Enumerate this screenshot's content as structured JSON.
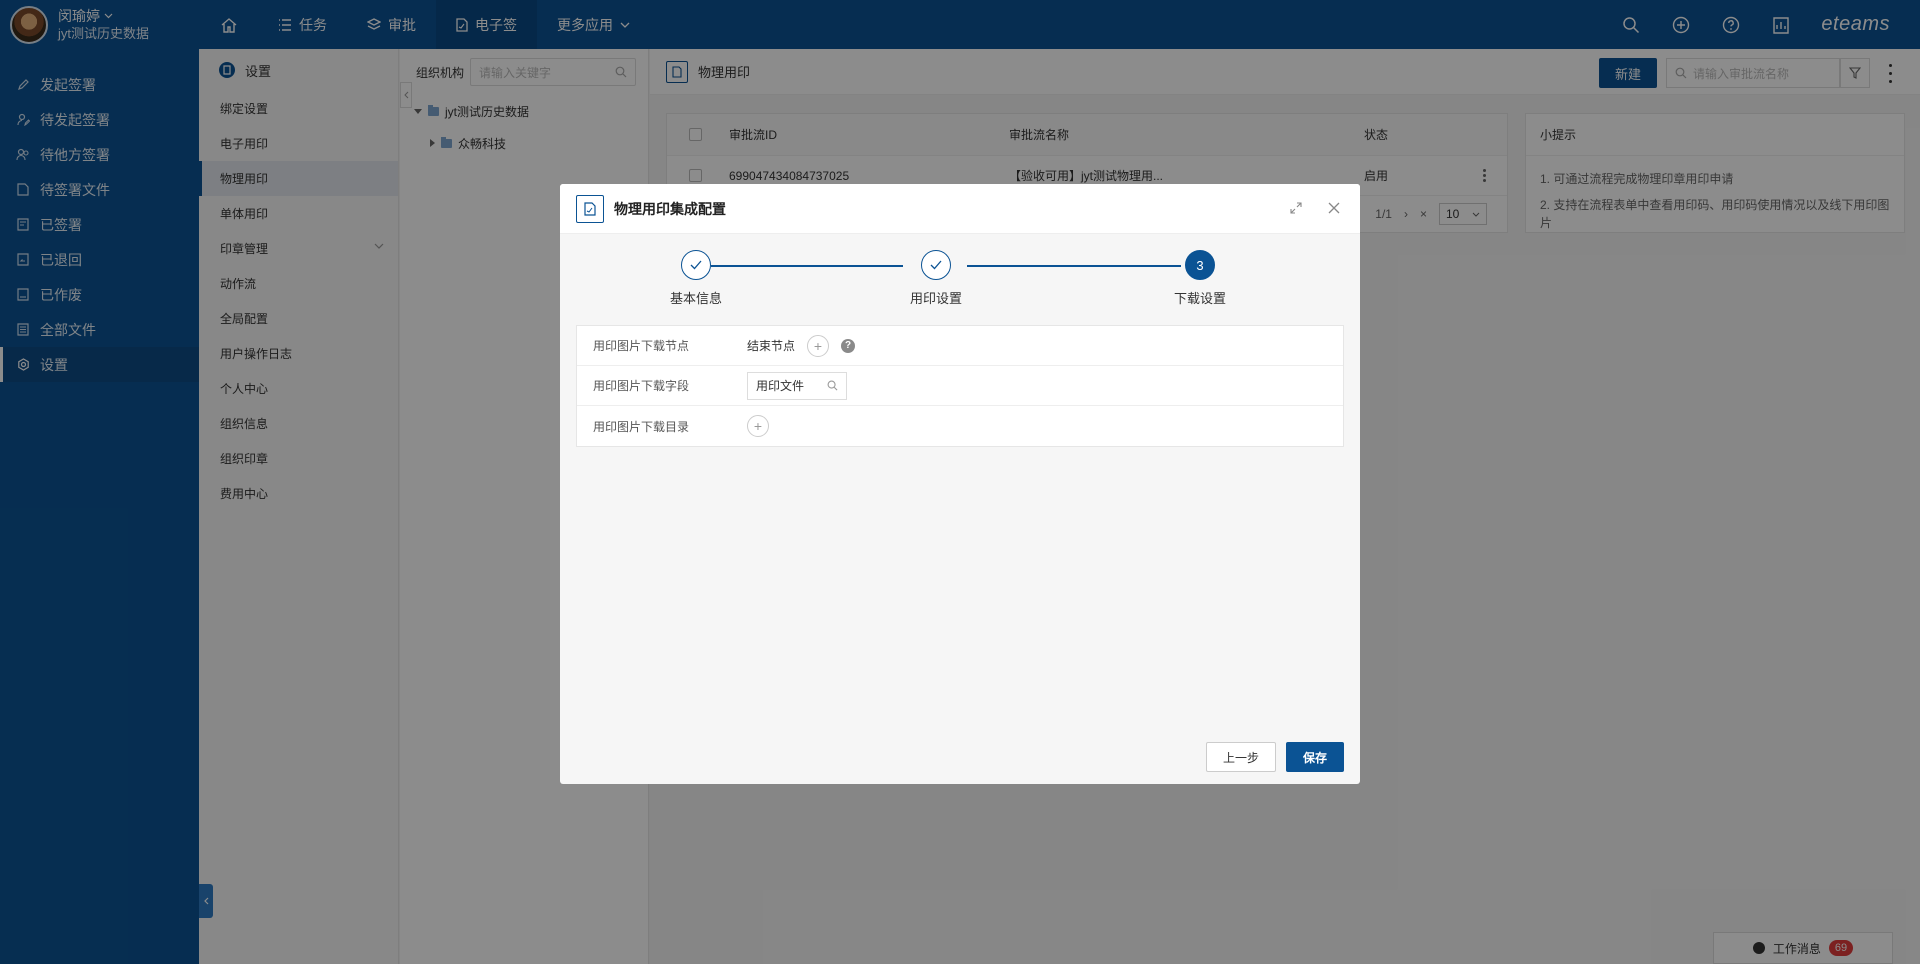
{
  "user": {
    "name": "闵瑜婷",
    "org": "jyt测试历史数据"
  },
  "nav": [
    {
      "label": "",
      "icon": "home-icon"
    },
    {
      "label": "任务",
      "icon": "list-icon"
    },
    {
      "label": "审批",
      "icon": "layers-icon"
    },
    {
      "label": "电子签",
      "icon": "document-icon",
      "active": true
    },
    {
      "label": "更多应用",
      "icon": "chevron-down-icon"
    }
  ],
  "brand": "eteams",
  "sidebar": {
    "items": [
      {
        "label": "发起签署"
      },
      {
        "label": "待发起签署"
      },
      {
        "label": "待他方签署"
      },
      {
        "label": "待签署文件"
      },
      {
        "label": "已签署"
      },
      {
        "label": "已退回"
      },
      {
        "label": "已作废"
      },
      {
        "label": "全部文件"
      },
      {
        "label": "设置",
        "active": true
      }
    ]
  },
  "settings": {
    "title": "设置",
    "items": [
      {
        "label": "绑定设置"
      },
      {
        "label": "电子用印"
      },
      {
        "label": "物理用印",
        "active": true
      },
      {
        "label": "单体用印"
      },
      {
        "label": "印章管理",
        "hasChevron": true
      },
      {
        "label": "动作流"
      },
      {
        "label": "全局配置"
      },
      {
        "label": "用户操作日志"
      },
      {
        "label": "个人中心"
      },
      {
        "label": "组织信息"
      },
      {
        "label": "组织印章"
      },
      {
        "label": "费用中心"
      }
    ]
  },
  "org": {
    "label": "组织机构",
    "placeholder": "请输入关键字",
    "root": "jyt测试历史数据",
    "child": "众畅科技"
  },
  "main": {
    "title": "物理用印",
    "new_label": "新建",
    "search_placeholder": "请输入审批流名称",
    "table": {
      "headers": [
        "审批流ID",
        "审批流名称",
        "状态"
      ],
      "rows": [
        {
          "id": "699047434084737025",
          "name": "【验收可用】jyt测试物理用...",
          "status": "启用"
        }
      ]
    },
    "pager": {
      "page": "1/1",
      "size": "10"
    },
    "tips": {
      "title": "小提示",
      "lines": [
        "1. 可通过流程完成物理印章用印申请",
        "2. 支持在流程表单中查看用印码、用印码使用情况以及线下用印图片"
      ]
    }
  },
  "message": {
    "label": "工作消息",
    "count": "69"
  },
  "modal": {
    "title": "物理用印集成配置",
    "steps": [
      {
        "label": "基本信息",
        "state": "done"
      },
      {
        "label": "用印设置",
        "state": "done"
      },
      {
        "label": "下载设置",
        "state": "current",
        "number": "3"
      }
    ],
    "fields": [
      {
        "label": "用印图片下载节点",
        "value": "结束节点"
      },
      {
        "label": "用印图片下载字段",
        "value": "用印文件"
      },
      {
        "label": "用印图片下载目录",
        "value": ""
      }
    ],
    "prev_label": "上一步",
    "save_label": "保存"
  }
}
